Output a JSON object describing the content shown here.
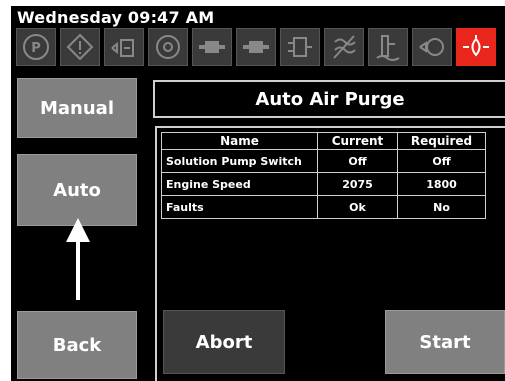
{
  "header": {
    "datetime": "Wednesday 09:47 AM"
  },
  "status_icons": [
    {
      "name": "parking-brake-icon",
      "alert": false
    },
    {
      "name": "warning-icon",
      "alert": false
    },
    {
      "name": "fuel-gauge-icon",
      "alert": false
    },
    {
      "name": "engine-icon",
      "alert": false
    },
    {
      "name": "pump-left-icon",
      "alert": false
    },
    {
      "name": "pump-right-icon",
      "alert": false
    },
    {
      "name": "heater-icon",
      "alert": false
    },
    {
      "name": "no-flow-icon",
      "alert": false
    },
    {
      "name": "tank-level-icon",
      "alert": false
    },
    {
      "name": "filter-icon",
      "alert": false
    },
    {
      "name": "oil-pressure-icon",
      "alert": true
    }
  ],
  "sidebar": {
    "manual": "Manual",
    "auto": "Auto",
    "back": "Back"
  },
  "title": "Auto Air Purge",
  "table": {
    "headers": [
      "Name",
      "Current",
      "Required"
    ],
    "rows": [
      [
        "Solution Pump Switch",
        "Off",
        "Off"
      ],
      [
        "Engine Speed",
        "2075",
        "1800"
      ],
      [
        "Faults",
        "Ok",
        "No"
      ]
    ]
  },
  "actions": {
    "abort": "Abort",
    "start": "Start"
  },
  "colors": {
    "alert": "#e8261c",
    "button": "#808080",
    "button_dark": "#3a3a3a",
    "background": "#000000"
  }
}
